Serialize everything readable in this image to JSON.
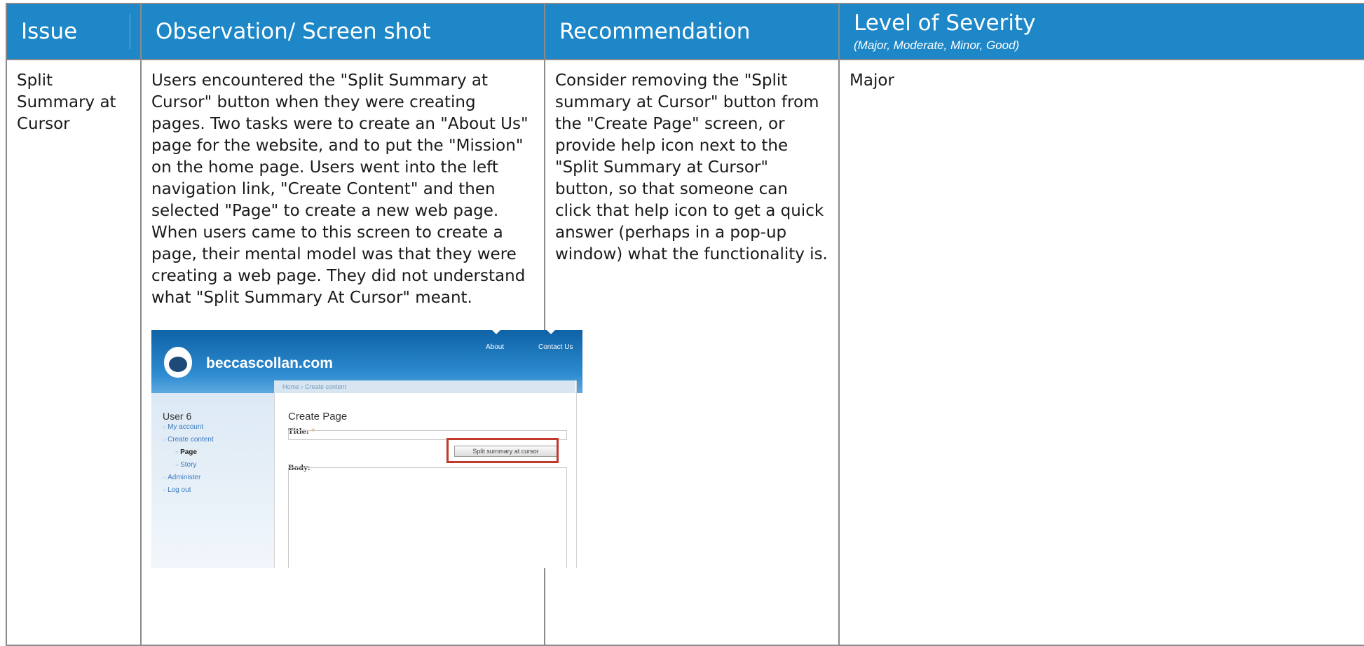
{
  "table": {
    "headers": {
      "issue": "Issue",
      "observation": "Observation/ Screen shot",
      "recommendation": "Recommendation",
      "severity": "Level of Severity",
      "severity_scale": "(Major, Moderate, Minor, Good)"
    },
    "row": {
      "issue": "Split Summary at Cursor",
      "observation": "Users encountered the \"Split Summary at Cursor\" button when they were creating pages. Two tasks were to create an \"About Us\" page for the website, and to put the \"Mission\" on the home page.  Users went into the left navigation link, \"Create Content\" and then selected \"Page\" to create a new web page.  When users came to this screen to create a page, their mental model was that they were creating a web page.  They did not understand what \"Split Summary At Cursor\" meant.",
      "recommendation": "Consider removing the \"Split summary at Cursor\" button from the \"Create Page\" screen, or provide help icon next to the \"Split Summary at Cursor\" button, so that someone can click that help icon to get a quick answer (perhaps in a pop-up window) what the functionality is.",
      "severity": "Major"
    }
  },
  "screenshot": {
    "site_name": "beccascollan.com",
    "nav": [
      "About",
      "Contact Us"
    ],
    "breadcrumb": "Home › Create content",
    "user": "User 6",
    "menu": [
      "My account",
      "Create content",
      "Page",
      "Story",
      "Administer",
      "Log out"
    ],
    "page_title": "Create Page",
    "title_label": "Title:",
    "required_mark": "*",
    "body_label": "Body:",
    "split_button": "Split summary at cursor"
  },
  "colors": {
    "header_bg": "#1e87c8",
    "highlight": "#c0392b"
  }
}
